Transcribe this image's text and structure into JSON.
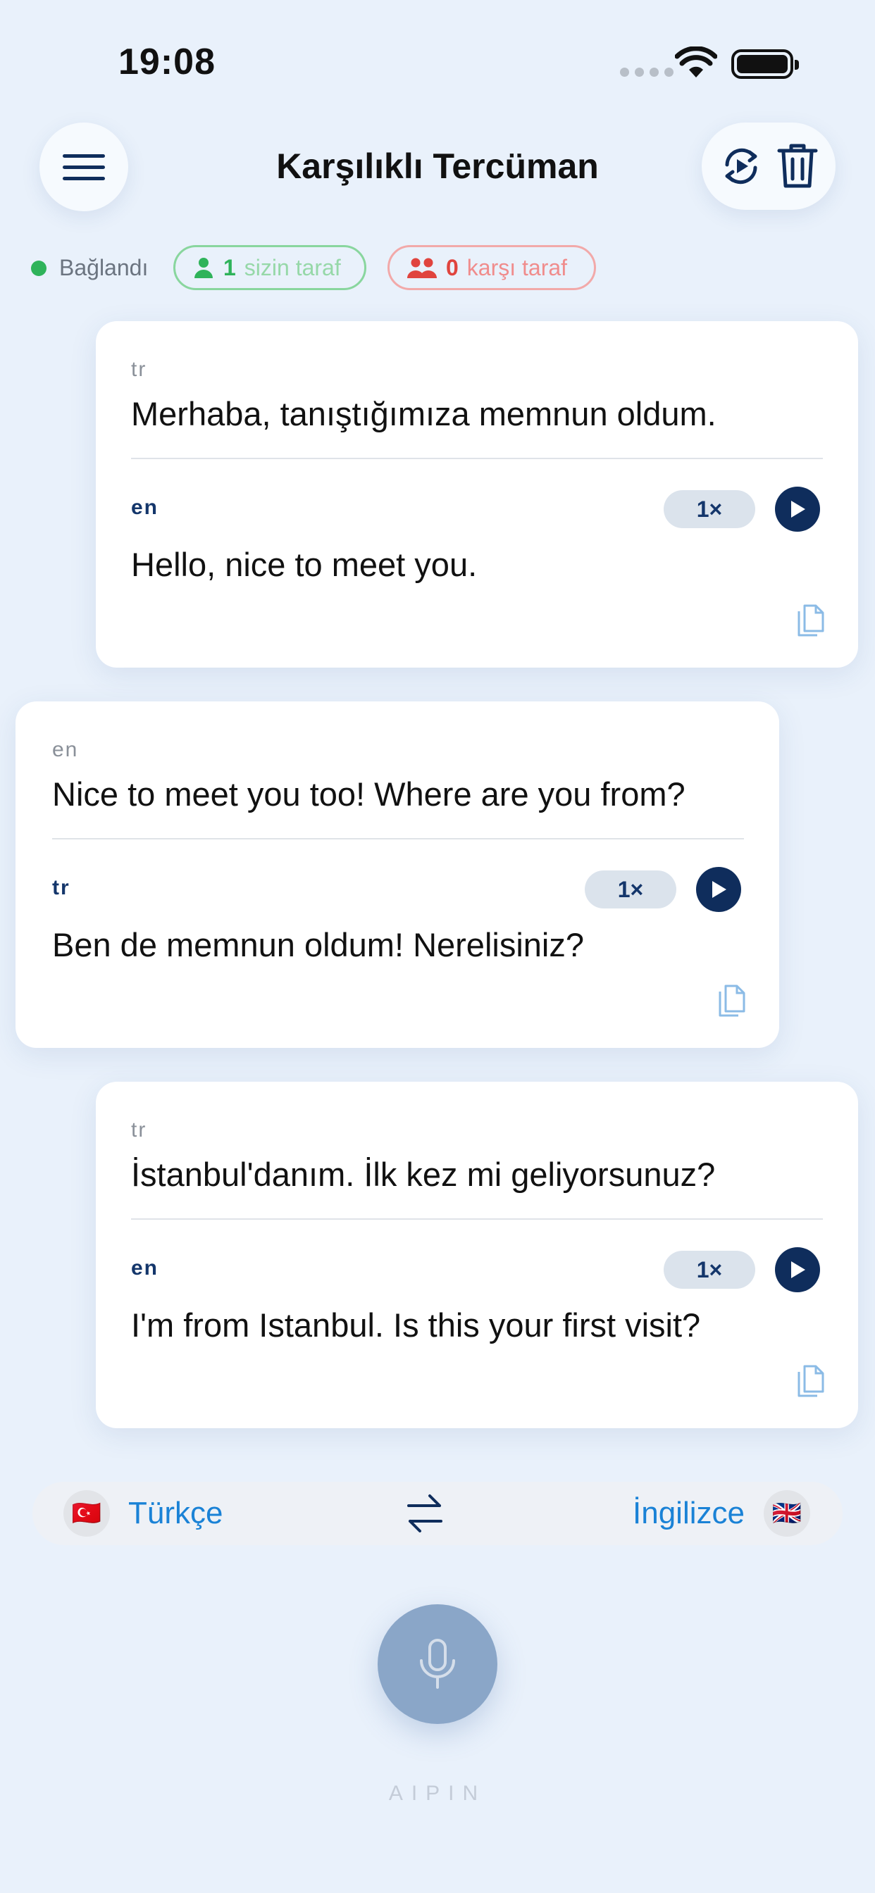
{
  "status_bar": {
    "time": "19:08"
  },
  "header": {
    "title": "Karşılıklı Tercüman",
    "menu_icon": "hamburger-menu-icon",
    "replay_icon": "replay-icon",
    "delete_icon": "trash-icon"
  },
  "status": {
    "connection": "Bağlandı",
    "my_side_count": "1",
    "my_side_label": "sizin taraf",
    "other_side_count": "0",
    "other_side_label": "karşı taraf"
  },
  "messages": [
    {
      "source_lang": "tr",
      "source_text": "Merhaba, tanıştığımıza memnun oldum.",
      "target_lang": "en",
      "target_text": "Hello, nice to meet you.",
      "speed": "1×"
    },
    {
      "source_lang": "en",
      "source_text": "Nice to meet you too! Where are you from?",
      "target_lang": "tr",
      "target_text": "Ben de memnun oldum! Nerelisiniz?",
      "speed": "1×"
    },
    {
      "source_lang": "tr",
      "source_text": "İstanbul'danım. İlk kez mi geliyorsunuz?",
      "target_lang": "en",
      "target_text": "I'm from Istanbul. Is this your first visit?",
      "speed": "1×"
    }
  ],
  "language_bar": {
    "left_language": "Türkçe",
    "left_flag": "🇹🇷",
    "right_language": "İngilizce",
    "right_flag": "🇬🇧",
    "swap_icon": "swap-arrows-icon"
  },
  "mic_icon": "microphone-icon",
  "brand": "AIPIN",
  "colors": {
    "background": "#e9f1fb",
    "navy": "#0f2d5c",
    "accent_blue": "#1a82d6",
    "connected_green": "#2fb35a",
    "other_side_red": "#e0443e",
    "mic_button": "#8aa6c8"
  }
}
